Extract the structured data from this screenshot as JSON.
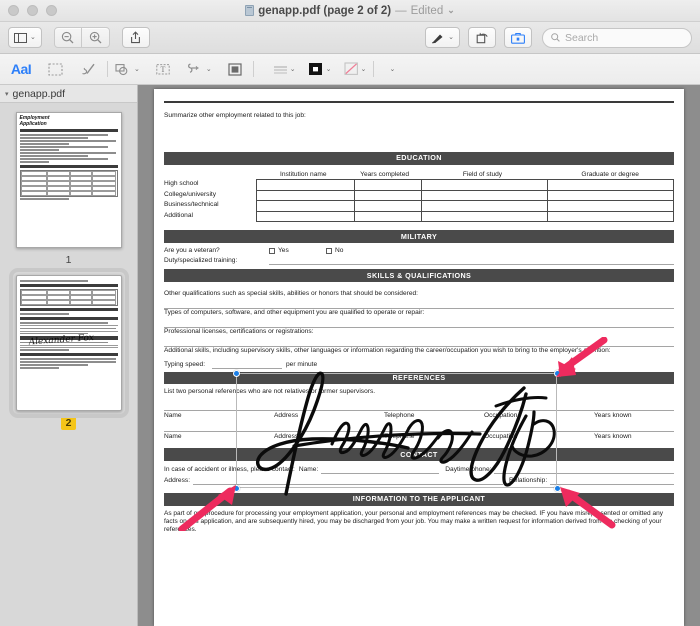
{
  "window": {
    "title": "genapp.pdf (page 2 of 2)",
    "title_separator": "—",
    "edited_label": "Edited",
    "chevron": "⌄",
    "traffic_lights": [
      "close",
      "minimize",
      "zoom"
    ]
  },
  "toolbar": {
    "sidebar_button": "sidebar-view",
    "sidebar_chevron": "⌄",
    "zoom_out": "zoom-out",
    "zoom_in": "zoom-in",
    "share": "share",
    "markup_pen": "markup-pen",
    "markup_chevron": "⌄",
    "rotate": "rotate-left",
    "toolkit": "annotation-toolkit",
    "search_placeholder": "Search"
  },
  "markup_toolbar": {
    "text_style_label": "AaI",
    "items": [
      {
        "name": "text-selection-tool",
        "glyph": "AaI"
      },
      {
        "name": "rectangular-selection-tool",
        "glyph": "⬚"
      },
      {
        "name": "sketch-tool",
        "glyph": "✐"
      },
      {
        "name": "shapes-tool",
        "glyph": "◻"
      },
      {
        "name": "text-box-tool",
        "glyph": "T"
      },
      {
        "name": "signature-tool",
        "glyph": "℘"
      },
      {
        "name": "note-tool",
        "glyph": "▣"
      },
      {
        "name": "border-style-tool",
        "glyph": "≡"
      },
      {
        "name": "border-color-tool",
        "glyph": "■"
      },
      {
        "name": "fill-color-tool",
        "glyph": "◸"
      },
      {
        "name": "font-tool",
        "glyph": "A"
      }
    ]
  },
  "sidebar": {
    "header_title": "genapp.pdf",
    "disclosure": "▾",
    "thumbnails": [
      {
        "page_number": "1",
        "selected": false,
        "title_line1": "Employment",
        "title_line2": "Application"
      },
      {
        "page_number": "2",
        "selected": true,
        "signature_text": "Alexander Fox"
      }
    ]
  },
  "document": {
    "intro_prompt": "Summarize other employment related to this job:",
    "education": {
      "band": "EDUCATION",
      "columns": [
        "Institution name",
        "Years completed",
        "Field of study",
        "Graduate or degree"
      ],
      "rows": [
        "High school",
        "College/university",
        "Business/technical",
        "Additional"
      ]
    },
    "military": {
      "band": "MILITARY",
      "question": "Are you a veteran?",
      "yes_label": "Yes",
      "no_label": "No",
      "training_label": "Duty/specialized training:"
    },
    "skills": {
      "band": "SKILLS & QUALIFICATIONS",
      "line1": "Other qualifications such as special skills, abilities or honors that should be considered:",
      "line2": "Types of computers, software, and other equipment you are qualified to operate or repair:",
      "line3": "Professional licenses, certifications or registrations:",
      "line4": "Additional skills, including supervisory skills, other languages or information regarding the career/occupation you wish to bring to the employer's attention:",
      "typing_speed_label": "Typing speed:",
      "typing_speed_unit": "per minute"
    },
    "references": {
      "band": "REFERENCES",
      "instruction": "List two personal references who are not relatives or former supervisors.",
      "columns": [
        "Name",
        "Address",
        "Telephone",
        "Occupation",
        "Years known"
      ],
      "row_count": 2
    },
    "contact": {
      "band": "CONTACT",
      "line1_prefix": "In case of accident or illness, please contact:",
      "name_label": "Name:",
      "daytime_label": "Daytime phone:",
      "address_label": "Address:",
      "relationship_label": "Relationship:"
    },
    "applicant_info": {
      "band": "INFORMATION TO THE APPLICANT",
      "paragraph": "As part of our procedure for processing your employment application, your personal and employment references may be checked. IF you have misrepresented or omitted any facts on this application, and are subsequently hired, you may be discharged from your job. You may make a written request for information derived from the checking of your references."
    }
  },
  "annotation": {
    "signature_text": "Alexander Fox",
    "selection_handles": 4,
    "handle_color": "#1a7ee6",
    "arrow_color": "#ee2b5e",
    "arrows": [
      {
        "name": "arrow-top-right",
        "target": "top-right-resize-handle"
      },
      {
        "name": "arrow-bottom-left",
        "target": "bottom-left-resize-handle"
      },
      {
        "name": "arrow-bottom-right",
        "target": "bottom-right-resize-handle"
      }
    ]
  }
}
